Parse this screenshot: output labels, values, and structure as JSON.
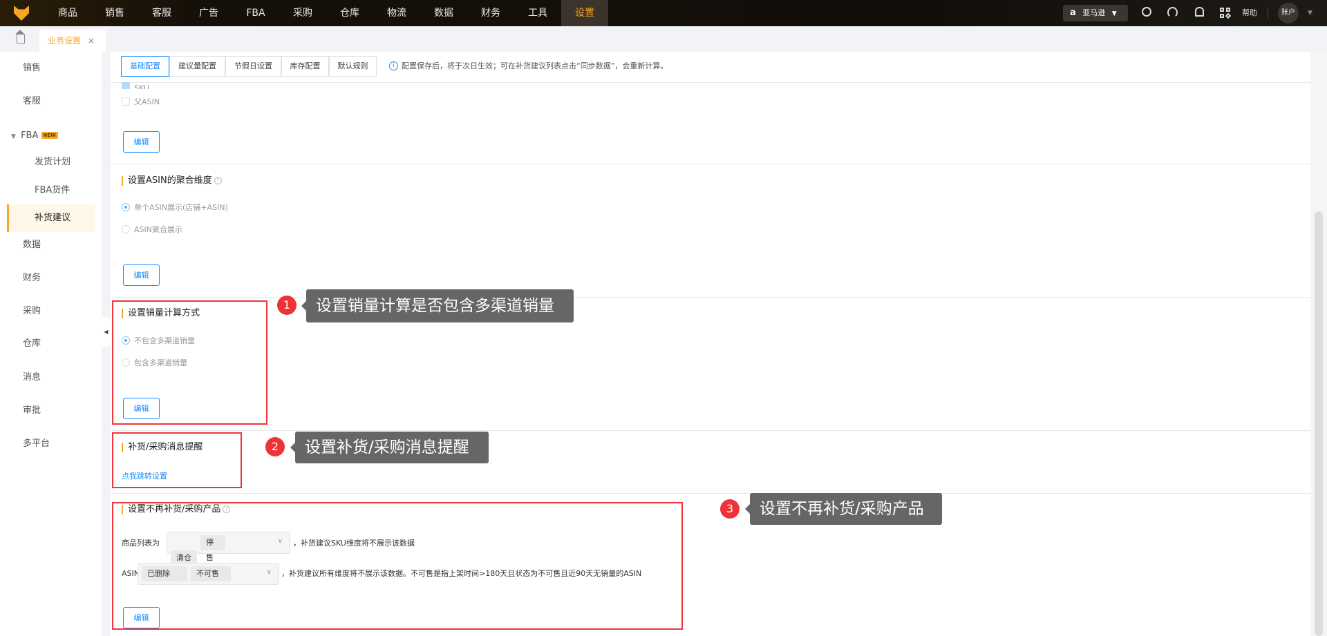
{
  "topnav": {
    "items": [
      "商品",
      "销售",
      "客服",
      "广告",
      "FBA",
      "采购",
      "仓库",
      "物流",
      "数据",
      "财务",
      "工具",
      "设置"
    ],
    "active": "设置",
    "marketplace": "亚马逊",
    "help": "帮助",
    "account": "账户"
  },
  "tabs": {
    "current": "业务设置"
  },
  "sidebar": {
    "items": [
      "销售",
      "客服"
    ],
    "fba": "FBA",
    "fba_badge": "NEW",
    "fba_sub": [
      "发货计划",
      "FBA货件",
      "补货建议"
    ],
    "rest": [
      "数据",
      "财务",
      "采购",
      "仓库",
      "消息",
      "审批",
      "多平台"
    ]
  },
  "config_tabs": [
    "基础配置",
    "建议量配置",
    "节假日设置",
    "库存配置",
    "默认规则"
  ],
  "info": "配置保存后，将于次日生效；可在补货建议列表点击“同步数据”，会重新计算。",
  "section0": {
    "options": [
      "SKU",
      "父ASIN"
    ],
    "edit": "编辑"
  },
  "section1": {
    "title": "设置ASIN的聚合维度",
    "options": [
      "单个ASIN展示(店铺+ASIN)",
      "ASIN聚合展示"
    ],
    "edit": "编辑"
  },
  "section2": {
    "title": "设置销量计算方式",
    "options": [
      "不包含多渠道销量",
      "包含多渠道销量"
    ],
    "edit": "编辑"
  },
  "section3": {
    "title": "补货/采购消息提醒",
    "link": "点我跳转设置"
  },
  "section4": {
    "title": "设置不再补货/采购产品",
    "row1_label": "商品列表为",
    "row1_tags": [
      "清仓",
      "停售"
    ],
    "row1_note": "，补货建议SKU维度将不展示该数据",
    "row2_label": "ASIN为",
    "row2_tags": [
      "已删除",
      "不可售"
    ],
    "row2_note": "，补货建议所有维度将不展示该数据。不可售是指上架时间>180天且状态为不可售且近90天无销量的ASIN",
    "edit": "编辑"
  },
  "callouts": [
    {
      "num": "1",
      "text": "设置销量计算是否包含多渠道销量"
    },
    {
      "num": "2",
      "text": "设置补货/采购消息提醒"
    },
    {
      "num": "3",
      "text": "设置不再补货/采购产品"
    }
  ]
}
